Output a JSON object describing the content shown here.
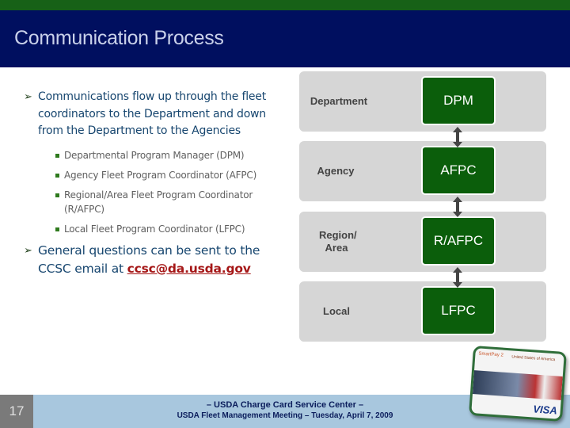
{
  "slide": {
    "title": "Communication Process",
    "page_number": "17"
  },
  "content": {
    "bullet1": "Communications flow up through the fleet coordinators to the Department and down from the Department to the Agencies",
    "sub_bullets": [
      "Departmental Program Manager (DPM)",
      "Agency Fleet Program Coordinator (AFPC)",
      "Regional/Area Fleet Program Coordinator (R/AFPC)",
      "Local Fleet Program Coordinator (LFPC)"
    ],
    "bullet2_prefix": "General questions can be sent to the CCSC email at ",
    "email": "ccsc@da.usda.gov"
  },
  "diagram": {
    "levels": [
      {
        "label": "Department",
        "role": "DPM"
      },
      {
        "label": "Agency",
        "role": "AFPC"
      },
      {
        "label": "Region/ Area",
        "role": "R/AFPC"
      },
      {
        "label": "Local",
        "role": "LFPC"
      }
    ]
  },
  "footer": {
    "line1": "– USDA Charge Card Service Center –",
    "line2": "USDA Fleet Management Meeting – Tuesday, April 7, 2009"
  },
  "card_image": {
    "brand": "SmartPay 2",
    "issuer_text": "United States of America",
    "network": "VISA"
  },
  "colors": {
    "header": "#000f5f",
    "top_band": "#176117",
    "role_box": "#0b5e0b",
    "footer": "#a8c7de"
  }
}
